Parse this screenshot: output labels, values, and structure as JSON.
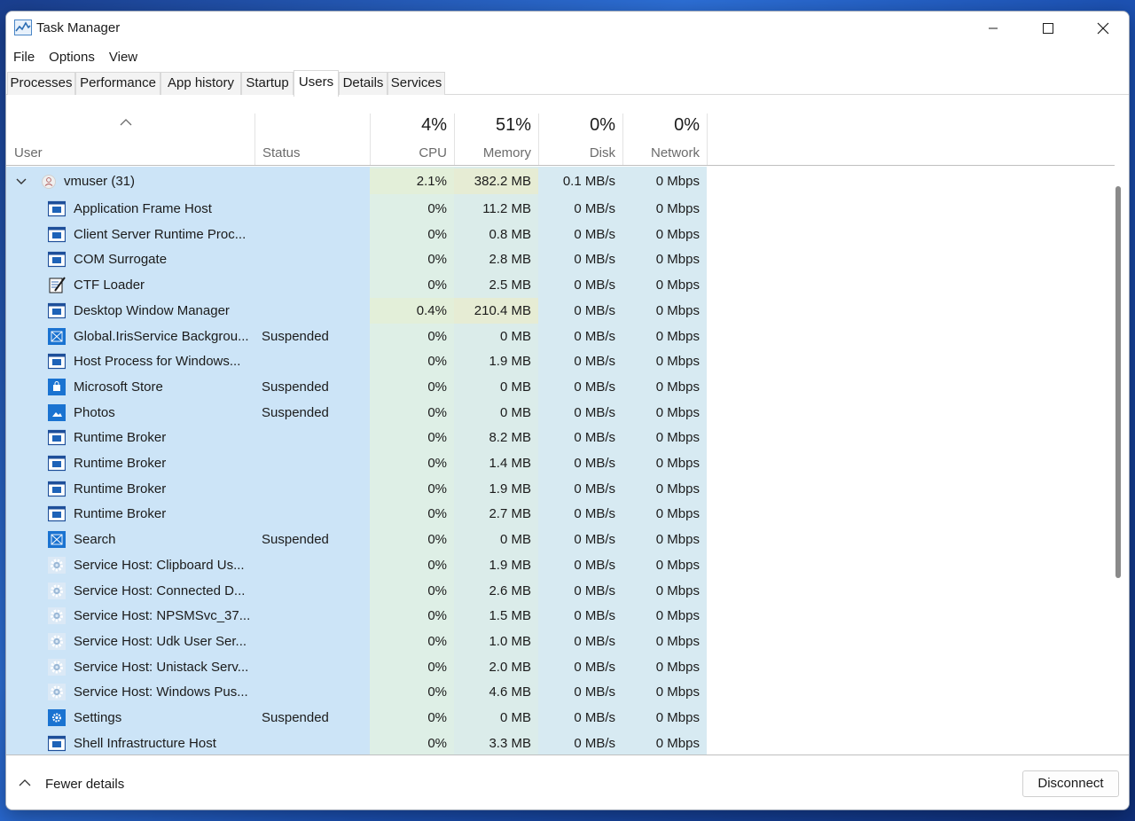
{
  "window": {
    "title": "Task Manager",
    "controls": [
      "minimize",
      "maximize",
      "close"
    ]
  },
  "menu": [
    "File",
    "Options",
    "View"
  ],
  "tabs": [
    {
      "label": "Processes",
      "active": false
    },
    {
      "label": "Performance",
      "active": false
    },
    {
      "label": "App history",
      "active": false
    },
    {
      "label": "Startup",
      "active": false
    },
    {
      "label": "Users",
      "active": true
    },
    {
      "label": "Details",
      "active": false
    },
    {
      "label": "Services",
      "active": false
    }
  ],
  "columns": {
    "user": "User",
    "status": "Status",
    "cpu": {
      "pct": "4%",
      "label": "CPU"
    },
    "memory": {
      "pct": "51%",
      "label": "Memory"
    },
    "disk": {
      "pct": "0%",
      "label": "Disk"
    },
    "network": {
      "pct": "0%",
      "label": "Network"
    }
  },
  "user_group": {
    "name": "vmuser (31)",
    "cpu": "2.1%",
    "memory": "382.2 MB",
    "disk": "0.1 MB/s",
    "network": "0 Mbps"
  },
  "processes": [
    {
      "name": "Application Frame Host",
      "status": "",
      "cpu": "0%",
      "memory": "11.2 MB",
      "disk": "0 MB/s",
      "network": "0 Mbps",
      "icon": "app-window-icon"
    },
    {
      "name": "Client Server Runtime Proc...",
      "status": "",
      "cpu": "0%",
      "memory": "0.8 MB",
      "disk": "0 MB/s",
      "network": "0 Mbps",
      "icon": "app-window-icon"
    },
    {
      "name": "COM Surrogate",
      "status": "",
      "cpu": "0%",
      "memory": "2.8 MB",
      "disk": "0 MB/s",
      "network": "0 Mbps",
      "icon": "app-window-icon"
    },
    {
      "name": "CTF Loader",
      "status": "",
      "cpu": "0%",
      "memory": "2.5 MB",
      "disk": "0 MB/s",
      "network": "0 Mbps",
      "icon": "ctf-notepad-icon"
    },
    {
      "name": "Desktop Window Manager",
      "status": "",
      "cpu": "0.4%",
      "memory": "210.4 MB",
      "disk": "0 MB/s",
      "network": "0 Mbps",
      "icon": "app-window-icon"
    },
    {
      "name": "Global.IrisService Backgrou...",
      "status": "Suspended",
      "cpu": "0%",
      "memory": "0 MB",
      "disk": "0 MB/s",
      "network": "0 Mbps",
      "icon": "blue-tile-icon"
    },
    {
      "name": "Host Process for Windows...",
      "status": "",
      "cpu": "0%",
      "memory": "1.9 MB",
      "disk": "0 MB/s",
      "network": "0 Mbps",
      "icon": "app-window-icon"
    },
    {
      "name": "Microsoft Store",
      "status": "Suspended",
      "cpu": "0%",
      "memory": "0 MB",
      "disk": "0 MB/s",
      "network": "0 Mbps",
      "icon": "store-icon"
    },
    {
      "name": "Photos",
      "status": "Suspended",
      "cpu": "0%",
      "memory": "0 MB",
      "disk": "0 MB/s",
      "network": "0 Mbps",
      "icon": "photos-icon"
    },
    {
      "name": "Runtime Broker",
      "status": "",
      "cpu": "0%",
      "memory": "8.2 MB",
      "disk": "0 MB/s",
      "network": "0 Mbps",
      "icon": "app-window-icon"
    },
    {
      "name": "Runtime Broker",
      "status": "",
      "cpu": "0%",
      "memory": "1.4 MB",
      "disk": "0 MB/s",
      "network": "0 Mbps",
      "icon": "app-window-icon"
    },
    {
      "name": "Runtime Broker",
      "status": "",
      "cpu": "0%",
      "memory": "1.9 MB",
      "disk": "0 MB/s",
      "network": "0 Mbps",
      "icon": "app-window-icon"
    },
    {
      "name": "Runtime Broker",
      "status": "",
      "cpu": "0%",
      "memory": "2.7 MB",
      "disk": "0 MB/s",
      "network": "0 Mbps",
      "icon": "app-window-icon"
    },
    {
      "name": "Search",
      "status": "Suspended",
      "cpu": "0%",
      "memory": "0 MB",
      "disk": "0 MB/s",
      "network": "0 Mbps",
      "icon": "blue-tile-icon"
    },
    {
      "name": "Service Host: Clipboard Us...",
      "status": "",
      "cpu": "0%",
      "memory": "1.9 MB",
      "disk": "0 MB/s",
      "network": "0 Mbps",
      "icon": "gear-icon"
    },
    {
      "name": "Service Host: Connected D...",
      "status": "",
      "cpu": "0%",
      "memory": "2.6 MB",
      "disk": "0 MB/s",
      "network": "0 Mbps",
      "icon": "gear-icon"
    },
    {
      "name": "Service Host: NPSMSvc_37...",
      "status": "",
      "cpu": "0%",
      "memory": "1.5 MB",
      "disk": "0 MB/s",
      "network": "0 Mbps",
      "icon": "gear-icon"
    },
    {
      "name": "Service Host: Udk User Ser...",
      "status": "",
      "cpu": "0%",
      "memory": "1.0 MB",
      "disk": "0 MB/s",
      "network": "0 Mbps",
      "icon": "gear-icon"
    },
    {
      "name": "Service Host: Unistack Serv...",
      "status": "",
      "cpu": "0%",
      "memory": "2.0 MB",
      "disk": "0 MB/s",
      "network": "0 Mbps",
      "icon": "gear-icon"
    },
    {
      "name": "Service Host: Windows Pus...",
      "status": "",
      "cpu": "0%",
      "memory": "4.6 MB",
      "disk": "0 MB/s",
      "network": "0 Mbps",
      "icon": "gear-icon"
    },
    {
      "name": "Settings",
      "status": "Suspended",
      "cpu": "0%",
      "memory": "0 MB",
      "disk": "0 MB/s",
      "network": "0 Mbps",
      "icon": "settings-icon"
    },
    {
      "name": "Shell Infrastructure Host",
      "status": "",
      "cpu": "0%",
      "memory": "3.3 MB",
      "disk": "0 MB/s",
      "network": "0 Mbps",
      "icon": "app-window-icon"
    }
  ],
  "footer": {
    "fewer_details": "Fewer details",
    "disconnect": "Disconnect"
  }
}
